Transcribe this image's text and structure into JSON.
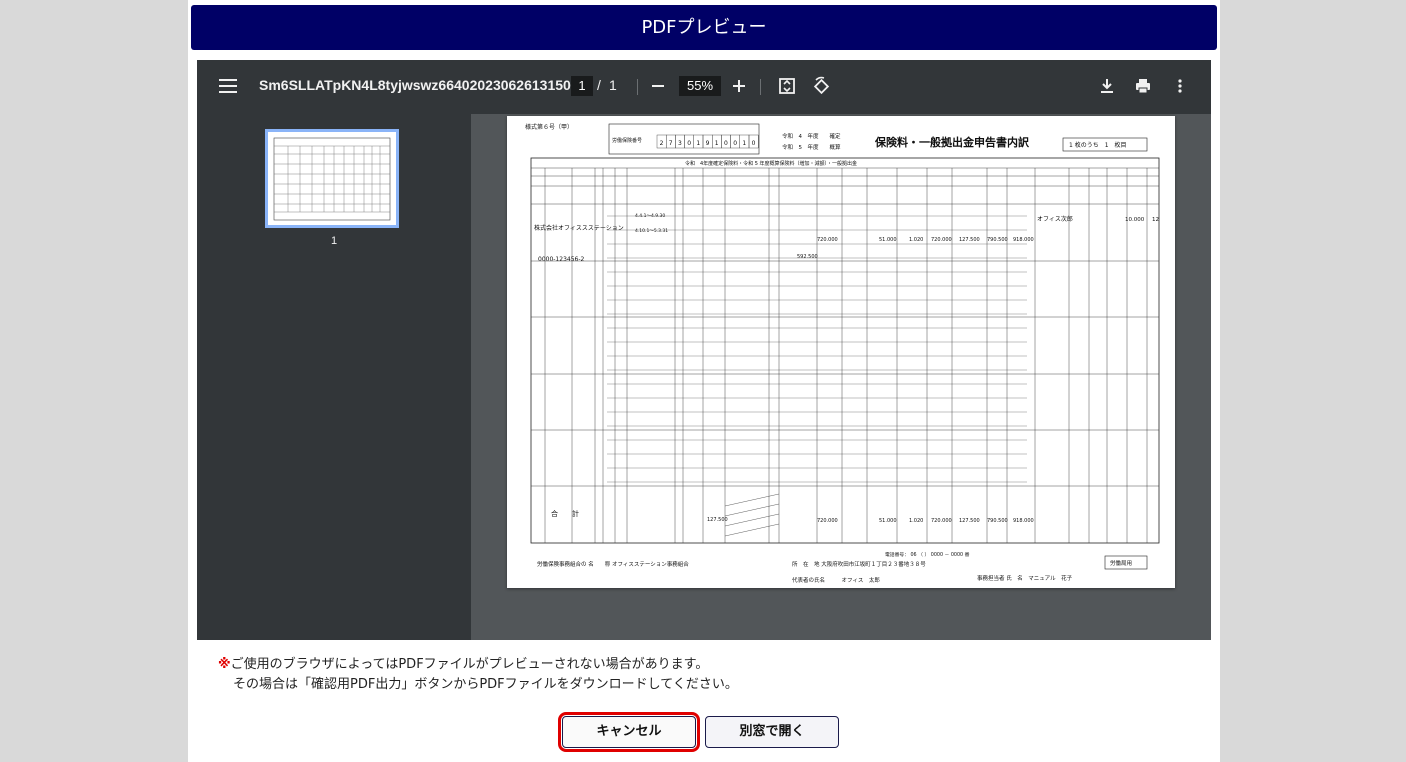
{
  "dialog": {
    "title": "PDFプレビュー"
  },
  "viewer": {
    "file_name": "Sm6SLLATpKN4L8tyjwswz664020230626131509",
    "current_page": "1",
    "page_separator": "/",
    "total_pages": "1",
    "zoom": "55%",
    "thumbnail_label": "1"
  },
  "document": {
    "form_number": "様式第６号（甲）",
    "doc_title": "保険料・一般拠出金申告書内訳",
    "sheet_count": "1 枚のうち　1　枚目",
    "year_confirmed": "令和　4　年度　　確定",
    "year_estimated": "令和　5　年度　　概算",
    "insurance_no_label": "労働保険番号",
    "insurance_digits": [
      "2",
      "7",
      "3",
      "0",
      "1",
      "9",
      "1",
      "0",
      "0",
      "1",
      "0"
    ],
    "header_row": "令和　4年度確定保険料・令和 5 年度概算保険料（増加・減額）・一般拠出金",
    "company_name": "株式会社オフィススステーション",
    "company_code": "0000-123456-2",
    "worker_name": "オフィス次郎",
    "total_label": "合　　計",
    "period_a": "4.4.1〜4.9.30",
    "period_b": "4.10.1〜5.3.31",
    "amounts": [
      "720.000",
      "51.000",
      "1.020",
      "720.000",
      "127.500",
      "790.500",
      "918.000"
    ],
    "amount_small": "127.500",
    "amount_592": "592.500",
    "amount_10000": "10.000",
    "amount_12": "12",
    "union_line": "労働保険事務組合の 名　　称 オフィスステーション事務組合",
    "address_line": "所　在　地 大阪府吹田市江坂町１丁目２３番地３８号",
    "phone_line": "電話番号： 06 （ ） 0000 － 0000 番",
    "rep_line": "代表者の氏名　　　オフィス　太郎",
    "contact_line": "事務担当者 氏　名　マニュアル　花子",
    "bureau_box": "労働局用"
  },
  "notice": {
    "mark": "※",
    "line1": "ご使用のブラウザによってはPDFファイルがプレビューされない場合があります。",
    "line2": "その場合は「確認用PDF出力」ボタンからPDFファイルをダウンロードしてください。"
  },
  "buttons": {
    "cancel": "キャンセル",
    "open_new_window": "別窓で開く"
  },
  "icons": {
    "menu": "menu-icon",
    "zoom_out": "minus-icon",
    "zoom_in": "plus-icon",
    "fit": "fit-page-icon",
    "rotate": "rotate-icon",
    "download": "download-icon",
    "print": "print-icon",
    "more": "more-vert-icon"
  },
  "colors": {
    "header_bg": "#000066",
    "highlight": "#e00000",
    "thumbnail_border": "#8ab4f8"
  }
}
